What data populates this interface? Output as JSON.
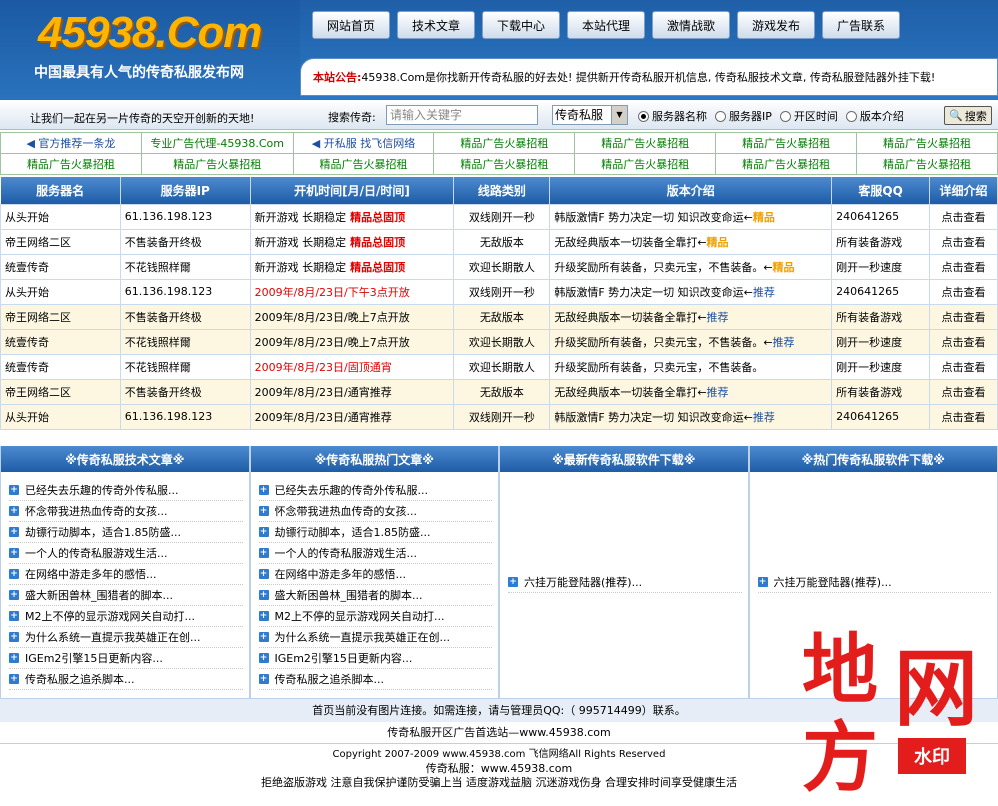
{
  "header": {
    "logo": "45938.Com",
    "slogan": "中国最具有人气的传奇私服发布网",
    "nav": [
      "网站首页",
      "技术文章",
      "下载中心",
      "本站代理",
      "激情战歌",
      "游戏发布",
      "广告联系"
    ],
    "notice_label": "本站公告:",
    "notice_text": "45938.Com是你找新开传奇私服的好去处! 提供新开传奇私服开机信息, 传奇私服技术文章, 传奇私服登陆器外挂下载!"
  },
  "search": {
    "welcome": "让我们一起在另一片传奇的天空开创新的天地!",
    "label": "搜索传奇:",
    "placeholder": "请输入关键字",
    "select_value": "传奇私服",
    "radios": [
      {
        "label": "服务器名称",
        "checked": true
      },
      {
        "label": "服务器IP",
        "checked": false
      },
      {
        "label": "开区时间",
        "checked": false
      },
      {
        "label": "版本介绍",
        "checked": false
      }
    ],
    "button": "搜索"
  },
  "ads": [
    [
      "官方推荐一条龙",
      "专业广告代理-45938.Com",
      "开私服 找飞信网络",
      "精品广告火暴招租",
      "精品广告火暴招租",
      "精品广告火暴招租",
      "精品广告火暴招租"
    ],
    [
      "精品广告火暴招租",
      "精品广告火暴招租",
      "精品广告火暴招租",
      "精品广告火暴招租",
      "精品广告火暴招租",
      "精品广告火暴招租",
      "精品广告火暴招租"
    ]
  ],
  "servers": {
    "headers": [
      "服务器名",
      "服务器IP",
      "开机时间[月/日/时间]",
      "线路类别",
      "版本介绍",
      "客服QQ",
      "详细介绍"
    ],
    "rows": [
      {
        "name": "从头开始",
        "ip": "61.136.198.123",
        "time": "新开游戏 长期稳定",
        "tag": "精品总固顶",
        "line": "双线刚开一秒",
        "desc": "韩版激情F 势力决定一切 知识改变命运←",
        "badge": "精品",
        "qq": "240641265",
        "detail": "点击查看",
        "style": "top"
      },
      {
        "name": "帝王网络二区",
        "ip": "不售装备开终极",
        "time": "新开游戏 长期稳定",
        "tag": "精品总固顶",
        "line": "无敌版本",
        "desc": "无敌经典版本一切装备全靠打←",
        "badge": "精品",
        "qq": "所有装备游戏",
        "detail": "点击查看",
        "style": "top"
      },
      {
        "name": "统壹传奇",
        "ip": "不花钱照样爾",
        "time": "新开游戏 长期稳定",
        "tag": "精品总固顶",
        "line": "欢迎长期散人",
        "desc": "升级奖励所有装备，只卖元宝，不售装备。←",
        "badge": "精品",
        "qq": "刚开一秒速度",
        "detail": "点击查看",
        "style": "top"
      },
      {
        "name": "从头开始",
        "ip": "61.136.198.123",
        "time": "2009年/8月/23日/下午3点开放",
        "tag": "",
        "line": "双线刚开一秒",
        "desc": "韩版激情F 势力决定一切 知识改变命运←",
        "badge": "推荐",
        "qq": "240641265",
        "detail": "点击查看",
        "style": "red"
      },
      {
        "name": "帝王网络二区",
        "ip": "不售装备开终极",
        "time": "2009年/8月/23日/晚上7点开放",
        "tag": "",
        "line": "无敌版本",
        "desc": "无敌经典版本一切装备全靠打←",
        "badge": "推荐",
        "qq": "所有装备游戏",
        "detail": "点击查看",
        "style": "alt"
      },
      {
        "name": "统壹传奇",
        "ip": "不花钱照样爾",
        "time": "2009年/8月/23日/晚上7点开放",
        "tag": "",
        "line": "欢迎长期散人",
        "desc": "升级奖励所有装备，只卖元宝，不售装备。←",
        "badge": "推荐",
        "qq": "刚开一秒速度",
        "detail": "点击查看",
        "style": "alt"
      },
      {
        "name": "统壹传奇",
        "ip": "不花钱照样爾",
        "time": "2009年/8月/23日/固顶通宵",
        "tag": "",
        "line": "欢迎长期散人",
        "desc": "升级奖励所有装备，只卖元宝，不售装备。",
        "badge": "",
        "qq": "刚开一秒速度",
        "detail": "点击查看",
        "style": "red"
      },
      {
        "name": "帝王网络二区",
        "ip": "不售装备开终极",
        "time": "2009年/8月/23日/通宵推荐",
        "tag": "",
        "line": "无敌版本",
        "desc": "无敌经典版本一切装备全靠打←",
        "badge": "推荐",
        "qq": "所有装备游戏",
        "detail": "点击查看",
        "style": "alt"
      },
      {
        "name": "从头开始",
        "ip": "61.136.198.123",
        "time": "2009年/8月/23日/通宵推荐",
        "tag": "",
        "line": "双线刚开一秒",
        "desc": "韩版激情F 势力决定一切 知识改变命运←",
        "badge": "推荐",
        "qq": "240641265",
        "detail": "点击查看",
        "style": "alt"
      }
    ]
  },
  "columns": [
    {
      "title": "※传奇私服技术文章※",
      "items": [
        "已经失去乐趣的传奇外传私服...",
        "怀念带我进热血传奇的女孩...",
        "劫镖行动脚本，适合1.85防盛...",
        "一个人的传奇私服游戏生活...",
        "在网络中游走多年的感悟...",
        "盛大新困兽林_围猎者的脚本...",
        "M2上不停的显示游戏网关自动打...",
        "为什么系统一直提示我英雄正在创...",
        "IGEm2引擎15日更新内容...",
        "传奇私服之追杀脚本..."
      ]
    },
    {
      "title": "※传奇私服热门文章※",
      "items": [
        "已经失去乐趣的传奇外传私服...",
        "怀念带我进热血传奇的女孩...",
        "劫镖行动脚本，适合1.85防盛...",
        "一个人的传奇私服游戏生活...",
        "在网络中游走多年的感悟...",
        "盛大新困兽林_围猎者的脚本...",
        "M2上不停的显示游戏网关自动打...",
        "为什么系统一直提示我英雄正在创...",
        "IGEm2引擎15日更新内容...",
        "传奇私服之追杀脚本..."
      ]
    },
    {
      "title": "※最新传奇私服软件下载※",
      "items": [
        "六挂万能登陆器(推荐)..."
      ]
    },
    {
      "title": "※热门传奇私服软件下载※",
      "items": [
        "六挂万能登陆器(推荐)..."
      ]
    }
  ],
  "footer": {
    "line1": "首页当前没有图片连接。如需连接，请与管理员QQ:（ 995714499）联系。",
    "line2": "传奇私服开区广告首选站—www.45938.com",
    "line3": "Copyright 2007-2009 www.45938.com 飞信网络All Rights Reserved",
    "line4": "传奇私服：www.45938.com",
    "line5": "拒绝盗版游戏 注意自我保护谨防受骗上当 适度游戏益脑 沉迷游戏伤身 合理安排时间享受健康生活"
  },
  "watermark": {
    "chars": [
      "地",
      "方",
      "网"
    ],
    "tag": "水印"
  }
}
